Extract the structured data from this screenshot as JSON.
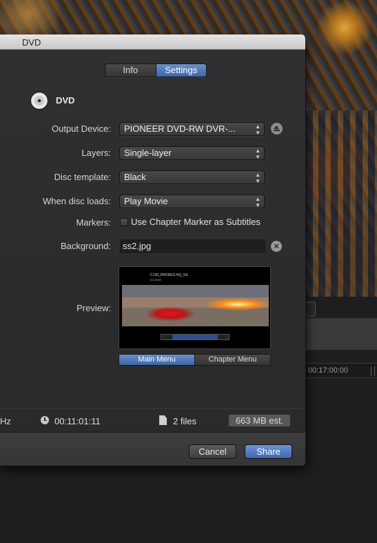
{
  "sheet": {
    "title": "DVD",
    "tabs": [
      {
        "label": "Info",
        "active": false
      },
      {
        "label": "Settings",
        "active": true
      }
    ],
    "section_title": "DVD",
    "fields": {
      "output_device": {
        "label": "Output Device:",
        "value": "PIONEER DVD-RW  DVR-..."
      },
      "layers": {
        "label": "Layers:",
        "value": "Single-layer"
      },
      "disc_template": {
        "label": "Disc template:",
        "value": "Black"
      },
      "when_disc_loads": {
        "label": "When disc loads:",
        "value": "Play Movie"
      },
      "markers": {
        "label": "Markers:",
        "checkbox_label": "Use Chapter Marker as Subtitles",
        "checked": false
      },
      "background": {
        "label": "Background:",
        "value": "ss2.jpg"
      },
      "preview": {
        "label": "Preview:"
      }
    },
    "preview": {
      "title_text": "C130_PRORES-HQ_SS",
      "time_text": "01:23:56",
      "menu_tabs": [
        {
          "label": "Main Menu",
          "active": true
        },
        {
          "label": "Chapter Menu",
          "active": false
        }
      ]
    },
    "info": {
      "hz": "Hz",
      "duration": "00:11:01:11",
      "files": "2 files",
      "estimate": "663 MB est."
    },
    "buttons": {
      "cancel": "Cancel",
      "share": "Share"
    }
  },
  "background_app": {
    "ruler_timecode": "00:17:00:00"
  }
}
